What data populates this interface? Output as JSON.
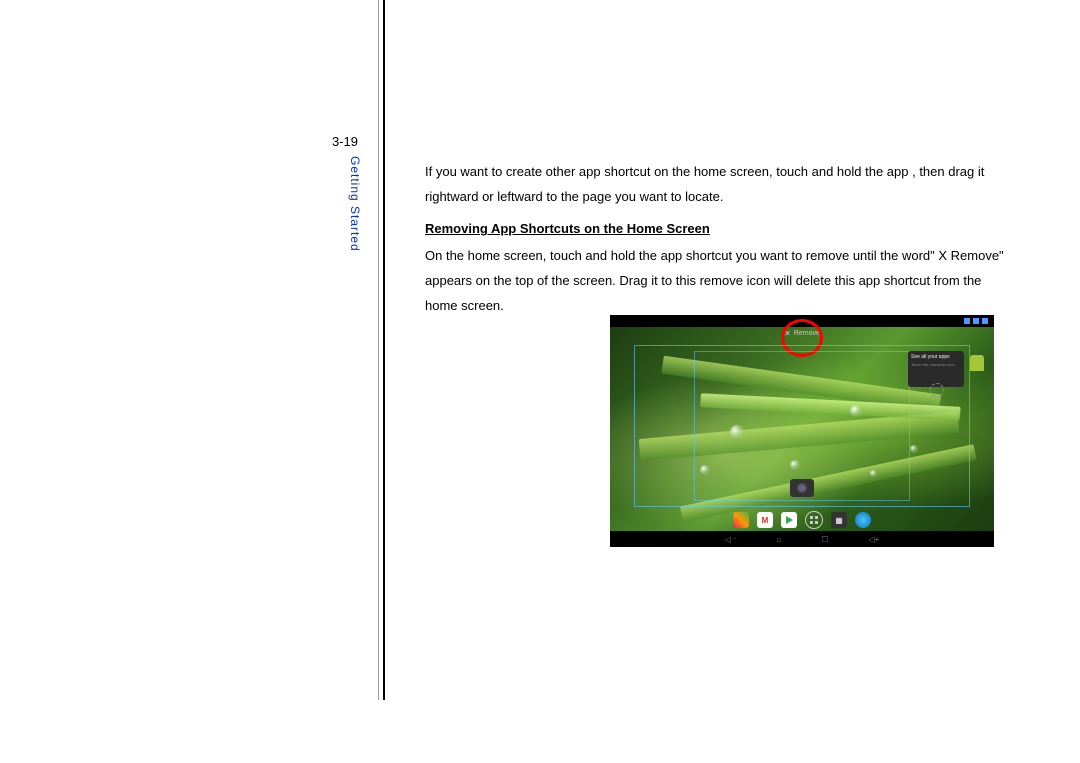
{
  "page_number": "3-19",
  "section_label": "Getting Started",
  "intro_para": "If you want to create other app shortcut on the home screen, touch and hold the app , then drag it rightward or leftward to the page you want to locate.",
  "heading": "Removing App Shortcuts on the Home Screen",
  "body_para": "On the home screen, touch and hold the app shortcut you want to remove until the word\" X Remove\" appears on the top of the screen. Drag it to this remove icon will delete this app shortcut from the home screen.",
  "screenshot": {
    "remove_label": "Remove",
    "widget_title": "See all your apps",
    "widget_subtitle": "Touch the Launcher icon",
    "nav": {
      "back": "◁",
      "home": "⌂",
      "recent": "☐",
      "vol": "◁+"
    },
    "dock": {
      "gmail_letter": "M"
    }
  }
}
